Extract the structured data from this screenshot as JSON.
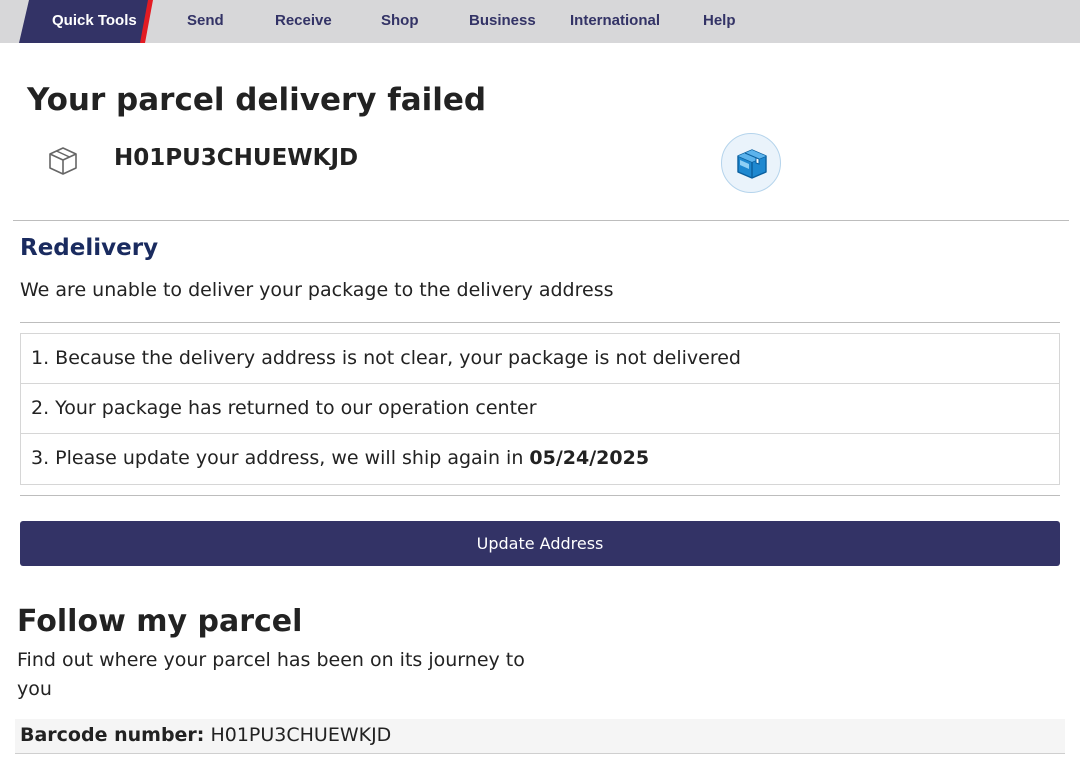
{
  "nav": {
    "items": [
      {
        "label": "Quick Tools",
        "active": true
      },
      {
        "label": "Send"
      },
      {
        "label": "Receive"
      },
      {
        "label": "Shop"
      },
      {
        "label": "Business"
      },
      {
        "label": "International"
      },
      {
        "label": "Help"
      }
    ]
  },
  "header": {
    "title": "Your parcel delivery failed",
    "tracking_id": "H01PU3CHUEWKJD",
    "tracking_icon": "box-outline-icon",
    "badge_icon": "package-icon"
  },
  "redelivery": {
    "title": "Redelivery",
    "text": "We are unable to deliver your package to the delivery address",
    "steps": [
      "1. Because the delivery address is not clear, your package is not delivered",
      "2. Your package has returned to our operation center",
      "3. Please update your address, we will ship again in "
    ],
    "ship_date": "05/24/2025",
    "button_label": "Update Address"
  },
  "follow": {
    "title": "Follow my parcel",
    "text": "Find out where your parcel has been on its journey to you",
    "barcode_label": "Barcode number:",
    "barcode_value": "H01PU3CHUEWKJD"
  },
  "colors": {
    "brand_navy": "#333366",
    "brand_red": "#e31b23",
    "heading_blue": "#1a2b5f"
  }
}
